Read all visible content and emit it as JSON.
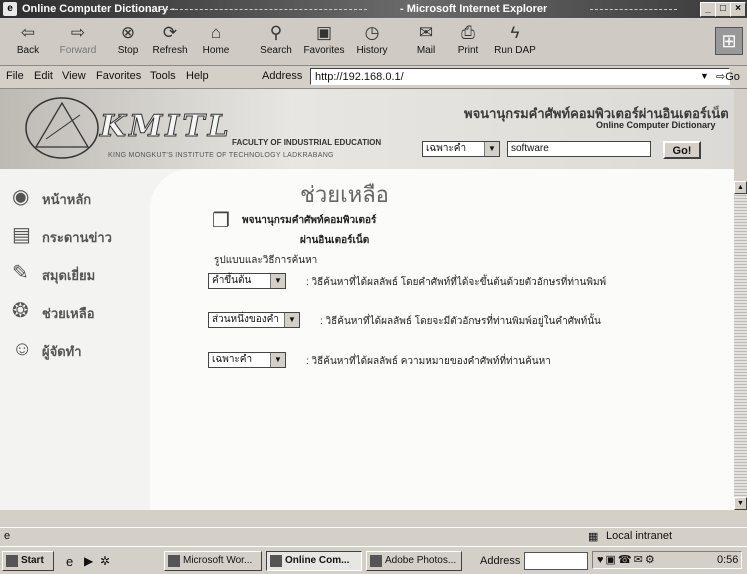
{
  "window": {
    "title_left": "Online Computer Dictionary -",
    "title_right": "- Microsoft Internet Explorer"
  },
  "toolbar": {
    "back": "Back",
    "forward": "Forward",
    "stop": "Stop",
    "refresh": "Refresh",
    "home": "Home",
    "search": "Search",
    "favorites": "Favorites",
    "history": "History",
    "mail": "Mail",
    "print": "Print",
    "rundap": "Run DAP"
  },
  "menu": {
    "file": "File",
    "edit": "Edit",
    "view": "View",
    "favorites": "Favorites",
    "tools": "Tools",
    "help": "Help",
    "address_label": "Address",
    "address_value": "http://192.168.0.1/",
    "go": "Go"
  },
  "banner": {
    "kmitl": "KMITL",
    "faculty": "FACULTY OF INDUSTRIAL EDUCATION",
    "institute": "KING MONGKUT'S INSTITUTE OF TECHNOLOGY LADKRABANG",
    "thai_title": "พจนานุกรมคำศัพท์คอมพิวเตอร์ผ่านอินเตอร์เน็ต",
    "en_title": "Online Computer Dictionary",
    "search_mode": "เฉพาะคำ",
    "search_value": "software",
    "go_button": "Go!"
  },
  "sidebar": {
    "items": [
      {
        "label": "หน้าหลัก"
      },
      {
        "label": "กระดานข่าว"
      },
      {
        "label": "สมุดเยี่ยม"
      },
      {
        "label": "ช่วยเหลือ"
      },
      {
        "label": "ผู้จัดทำ"
      }
    ]
  },
  "main": {
    "heading": "ช่วยเหลือ",
    "sub1": "พจนานุกรมคำศัพท์คอมพิวเตอร์",
    "sub2": "ผ่านอินเตอร์เน็ต",
    "form_label": "รูปแบบและวิธีการค้นหา",
    "rows": [
      {
        "select": "คำขึ้นต้น",
        "desc": ": วิธีค้นหาที่ได้ผลลัพธ์ โดยคำศัพท์ที่ได้จะขึ้นต้นด้วยตัวอักษรที่ท่านพิมพ์"
      },
      {
        "select": "ส่วนหนึ่งของคำ",
        "desc": ": วิธีค้นหาที่ได้ผลลัพธ์ โดยจะมีตัวอักษรที่ท่านพิมพ์อยู่ในคำศัพท์นั้น"
      },
      {
        "select": "เฉพาะคำ",
        "desc": ": วิธีค้นหาที่ได้ผลลัพธ์ ความหมายของคำศัพท์ที่ท่านค้นหา"
      }
    ]
  },
  "status": {
    "zone": "Local intranet"
  },
  "taskbar": {
    "start": "Start",
    "btn1": "Microsoft Wor...",
    "btn2": "Online Com...",
    "btn3": "Adobe Photos...",
    "address": "Address",
    "clock": "0:56"
  }
}
